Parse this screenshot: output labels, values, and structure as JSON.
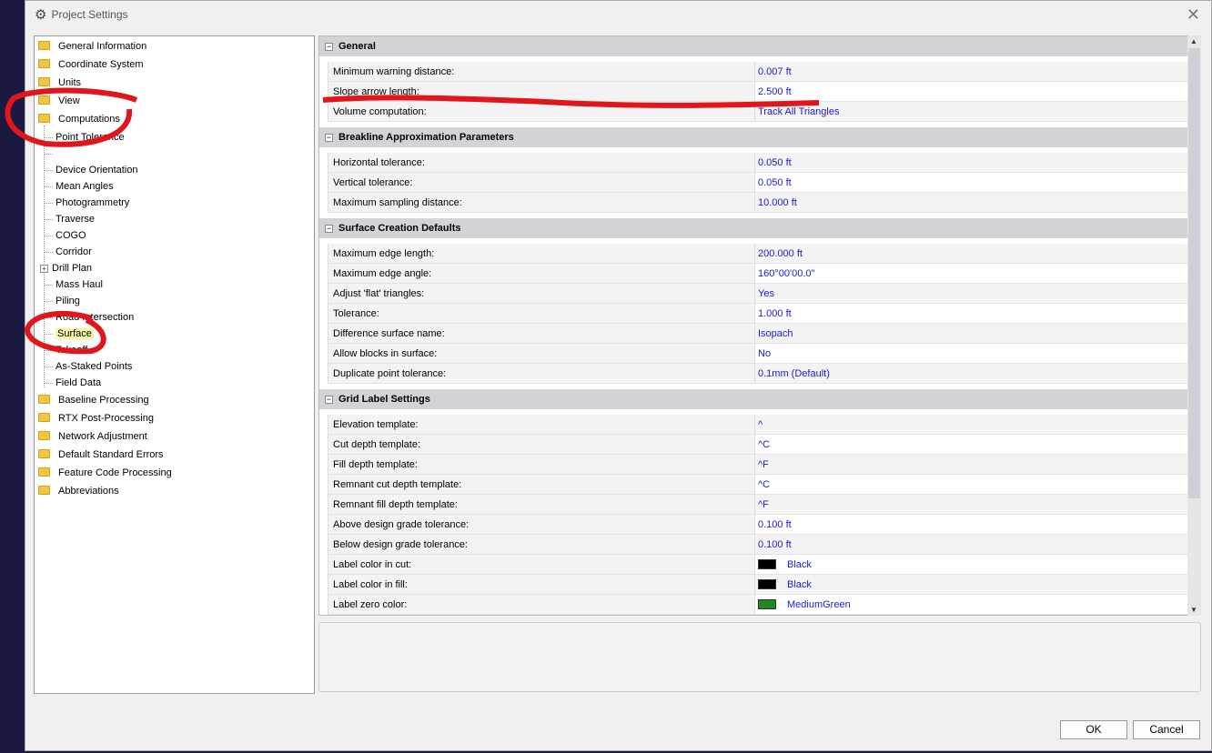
{
  "window": {
    "title": "Project Settings",
    "ok": "OK",
    "cancel": "Cancel"
  },
  "tree": {
    "top": [
      "General Information",
      "Coordinate System",
      "Units",
      "View",
      "Computations"
    ],
    "children": [
      "Point Tolerance",
      "",
      "Device Orientation",
      "Mean Angles",
      "Photogrammetry",
      "Traverse",
      "COGO",
      "Corridor",
      "Drill Plan",
      "Mass Haul",
      "Piling",
      "Road Intersection",
      "Surface",
      "Takeoff",
      "As-Staked Points",
      "Field Data"
    ],
    "bottom": [
      "Baseline Processing",
      "RTX Post-Processing",
      "Network Adjustment",
      "Default Standard Errors",
      "Feature Code Processing",
      "Abbreviations"
    ],
    "selected": "Surface"
  },
  "sections": [
    {
      "title": "General",
      "rows": [
        [
          "Minimum warning distance:",
          "0.007 ft"
        ],
        [
          "Slope arrow length:",
          "2.500 ft"
        ],
        [
          "Volume computation:",
          "Track All Triangles"
        ]
      ]
    },
    {
      "title": "Breakline Approximation Parameters",
      "rows": [
        [
          "Horizontal tolerance:",
          "0.050 ft"
        ],
        [
          "Vertical tolerance:",
          "0.050 ft"
        ],
        [
          "Maximum sampling distance:",
          "10.000 ft"
        ]
      ]
    },
    {
      "title": "Surface Creation Defaults",
      "rows": [
        [
          "Maximum edge length:",
          "200.000 ft"
        ],
        [
          "Maximum edge angle:",
          "160°00'00.0\""
        ],
        [
          "Adjust 'flat' triangles:",
          "Yes"
        ],
        [
          "Tolerance:",
          "1.000 ft"
        ],
        [
          "Difference surface name:",
          "Isopach"
        ],
        [
          "Allow blocks in surface:",
          "No"
        ],
        [
          "Duplicate point tolerance:",
          "0.1mm (Default)"
        ]
      ]
    },
    {
      "title": "Grid Label Settings",
      "rows": [
        [
          "Elevation template:",
          "^"
        ],
        [
          "Cut depth template:",
          "^C"
        ],
        [
          "Fill depth template:",
          "^F"
        ],
        [
          "Remnant cut depth template:",
          "^C"
        ],
        [
          "Remnant fill depth template:",
          "^F"
        ],
        [
          "Above design grade tolerance:",
          "0.100 ft"
        ],
        [
          "Below design grade tolerance:",
          "0.100 ft"
        ],
        [
          "Label color in cut:",
          "Black"
        ],
        [
          "Label color in fill:",
          "Black"
        ],
        [
          "Label zero color:",
          "MediumGreen"
        ]
      ]
    }
  ],
  "swatches": {
    "Black": "#000000",
    "MediumGreen": "#1f8a1f"
  },
  "annotation_color": "#e0161c"
}
